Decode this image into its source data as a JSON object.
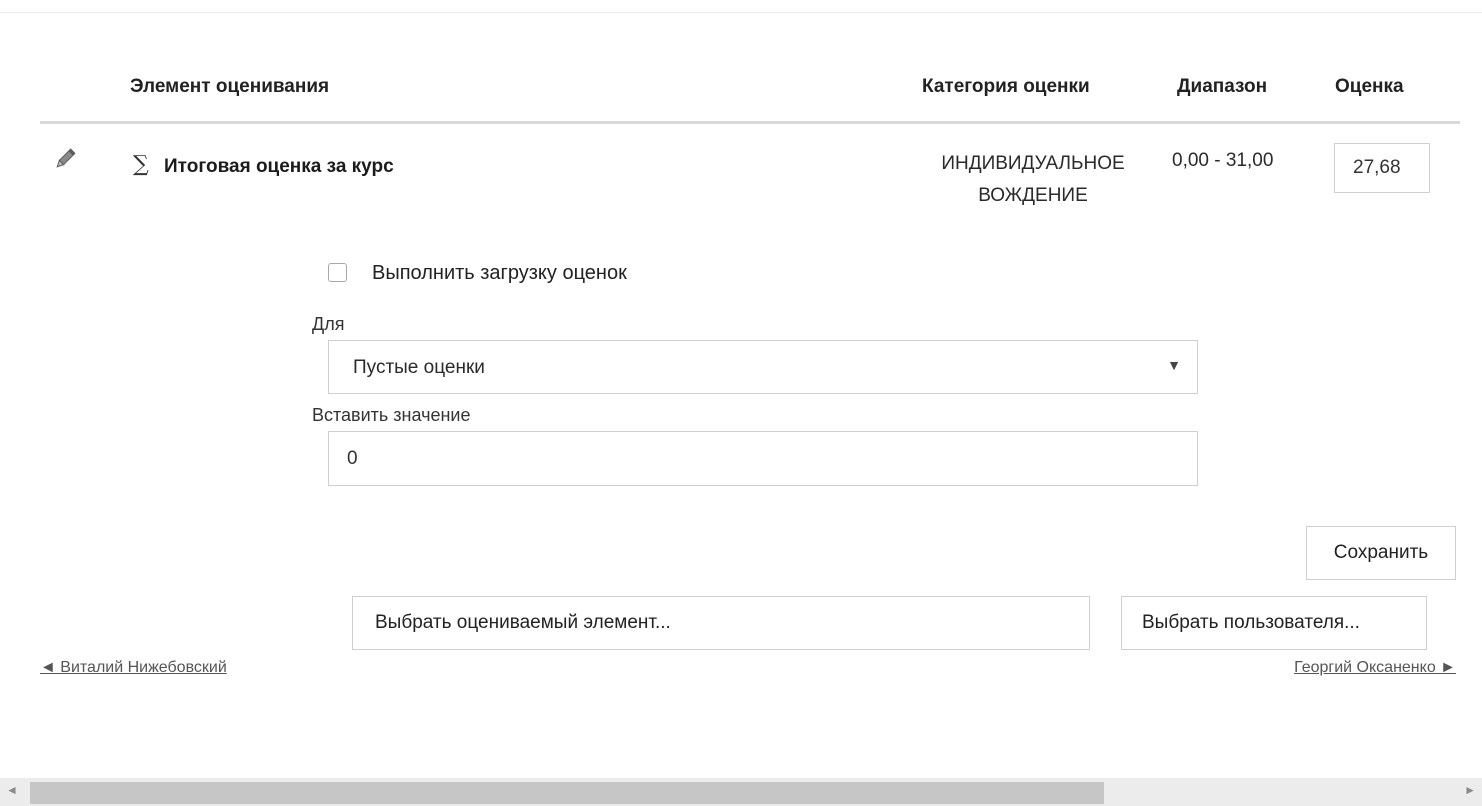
{
  "table": {
    "headers": {
      "item": "Элемент оценивания",
      "category": "Категория оценки",
      "range": "Диапазон",
      "grade": "Оценка"
    },
    "row": {
      "edit_icon": "pencil-icon",
      "total_icon": "sigma-icon",
      "total_symbol": "∑",
      "name": "Итоговая оценка за курс",
      "category_lines": [
        "ИНДИВИДУАЛЬНОЕ",
        "ВОЖДЕНИЕ"
      ],
      "range": "0,00 - 31,00",
      "grade": "27,68"
    }
  },
  "bulk": {
    "checkbox_label": "Выполнить загрузку оценок",
    "checked": false,
    "for_label": "Для",
    "for_value": "Пустые оценки",
    "insert_label": "Вставить значение",
    "insert_value": "0"
  },
  "actions": {
    "save": "Сохранить",
    "pick_item": "Выбрать оцениваемый элемент...",
    "pick_user": "Выбрать пользователя..."
  },
  "nav": {
    "prev": "◄ Виталий Нижебовский",
    "next": "Георгий Оксаненко ►"
  },
  "scrollbar": {
    "left_arrow": "◄",
    "right_arrow": "►"
  }
}
